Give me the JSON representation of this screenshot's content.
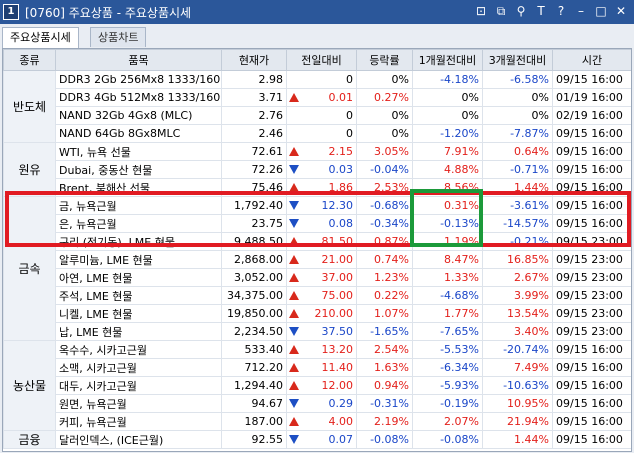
{
  "window": {
    "num": "1",
    "title": "[0760] 주요상품 - 주요상품시세"
  },
  "tabs": [
    {
      "label": "주요상품시세",
      "active": true
    },
    {
      "label": "상품차트",
      "active": false
    }
  ],
  "columns": [
    "종류",
    "품목",
    "현재가",
    "전일대비",
    "등락률",
    "1개월전대비",
    "3개월전대비",
    "시간"
  ],
  "groups": [
    {
      "category": "반도체",
      "rows": [
        {
          "item": "DDR3 2Gb 256Mx8 1333/1600MH",
          "price": "2.98",
          "dir": "",
          "change": "0",
          "rate": "0%",
          "m1": "-4.18%",
          "m3": "-6.58%",
          "time": "09/15 16:00"
        },
        {
          "item": "DDR3 4Gb 512Mx8 1333/1600MH",
          "price": "3.71",
          "dir": "up",
          "change": "0.01",
          "rate": "0.27%",
          "m1": "0%",
          "m3": "0%",
          "time": "01/19 16:00"
        },
        {
          "item": "NAND 32Gb 4Gx8 (MLC)",
          "price": "2.76",
          "dir": "",
          "change": "0",
          "rate": "0%",
          "m1": "0%",
          "m3": "0%",
          "time": "02/19 16:00"
        },
        {
          "item": "NAND 64Gb 8Gx8MLC",
          "price": "2.46",
          "dir": "",
          "change": "0",
          "rate": "0%",
          "m1": "-1.20%",
          "m3": "-7.87%",
          "time": "09/15 16:00"
        }
      ]
    },
    {
      "category": "원유",
      "rows": [
        {
          "item": "WTI, 뉴욕 선물",
          "price": "72.61",
          "dir": "up",
          "change": "2.15",
          "rate": "3.05%",
          "m1": "7.91%",
          "m3": "0.64%",
          "time": "09/15 16:00"
        },
        {
          "item": "Dubai, 중동산 현물",
          "price": "72.26",
          "dir": "down",
          "change": "0.03",
          "rate": "-0.04%",
          "m1": "4.88%",
          "m3": "-0.71%",
          "time": "09/15 16:00"
        },
        {
          "item": "Brent, 북해산 선물",
          "price": "75.46",
          "dir": "up",
          "change": "1.86",
          "rate": "2.53%",
          "m1": "8.56%",
          "m3": "1.44%",
          "time": "09/15 16:00"
        }
      ]
    },
    {
      "category": "금속",
      "rows": [
        {
          "item": "금, 뉴욕근월",
          "price": "1,792.40",
          "dir": "down",
          "change": "12.30",
          "rate": "-0.68%",
          "m1": "0.31%",
          "m3": "-3.61%",
          "time": "09/15 16:00"
        },
        {
          "item": "은, 뉴욕근월",
          "price": "23.75",
          "dir": "down",
          "change": "0.08",
          "rate": "-0.34%",
          "m1": "-0.13%",
          "m3": "-14.57%",
          "time": "09/15 16:00"
        },
        {
          "item": "구리 (전기동), LME 현물",
          "price": "9,488.50",
          "dir": "up",
          "change": "81.50",
          "rate": "0.87%",
          "m1": "1.19%",
          "m3": "-0.21%",
          "time": "09/15 23:00"
        },
        {
          "item": "알루미늄, LME 현물",
          "price": "2,868.00",
          "dir": "up",
          "change": "21.00",
          "rate": "0.74%",
          "m1": "8.47%",
          "m3": "16.85%",
          "time": "09/15 23:00"
        },
        {
          "item": "아연, LME 현물",
          "price": "3,052.00",
          "dir": "up",
          "change": "37.00",
          "rate": "1.23%",
          "m1": "1.33%",
          "m3": "2.67%",
          "time": "09/15 23:00"
        },
        {
          "item": "주석, LME 현물",
          "price": "34,375.00",
          "dir": "up",
          "change": "75.00",
          "rate": "0.22%",
          "m1": "-4.68%",
          "m3": "3.99%",
          "time": "09/15 23:00"
        },
        {
          "item": "니켈, LME 현물",
          "price": "19,850.00",
          "dir": "up",
          "change": "210.00",
          "rate": "1.07%",
          "m1": "1.77%",
          "m3": "13.54%",
          "time": "09/15 23:00"
        },
        {
          "item": "납, LME 현물",
          "price": "2,234.50",
          "dir": "down",
          "change": "37.50",
          "rate": "-1.65%",
          "m1": "-7.65%",
          "m3": "3.40%",
          "time": "09/15 23:00"
        }
      ]
    },
    {
      "category": "농산물",
      "rows": [
        {
          "item": "옥수수, 시카고근월",
          "price": "533.40",
          "dir": "up",
          "change": "13.20",
          "rate": "2.54%",
          "m1": "-5.53%",
          "m3": "-20.74%",
          "time": "09/15 16:00"
        },
        {
          "item": "소맥, 시카고근월",
          "price": "712.20",
          "dir": "up",
          "change": "11.40",
          "rate": "1.63%",
          "m1": "-6.34%",
          "m3": "7.49%",
          "time": "09/15 16:00"
        },
        {
          "item": "대두, 시카고근월",
          "price": "1,294.40",
          "dir": "up",
          "change": "12.00",
          "rate": "0.94%",
          "m1": "-5.93%",
          "m3": "-10.63%",
          "time": "09/15 16:00"
        },
        {
          "item": "원면, 뉴욕근월",
          "price": "94.67",
          "dir": "down",
          "change": "0.29",
          "rate": "-0.31%",
          "m1": "-0.19%",
          "m3": "10.95%",
          "time": "09/15 16:00"
        },
        {
          "item": "커피, 뉴욕근월",
          "price": "187.00",
          "dir": "up",
          "change": "4.00",
          "rate": "2.19%",
          "m1": "2.07%",
          "m3": "21.94%",
          "time": "09/15 16:00"
        }
      ]
    },
    {
      "category": "금융",
      "rows": [
        {
          "item": "달러인덱스, (ICE근월)",
          "price": "92.55",
          "dir": "down",
          "change": "0.07",
          "rate": "-0.08%",
          "m1": "-0.08%",
          "m3": "1.44%",
          "time": "09/15 16:00"
        }
      ]
    }
  ],
  "colors": {
    "up": "#e3201b",
    "down": "#1a46c8",
    "highlight_red": "#e11b22",
    "highlight_green": "#1c9a3a"
  }
}
